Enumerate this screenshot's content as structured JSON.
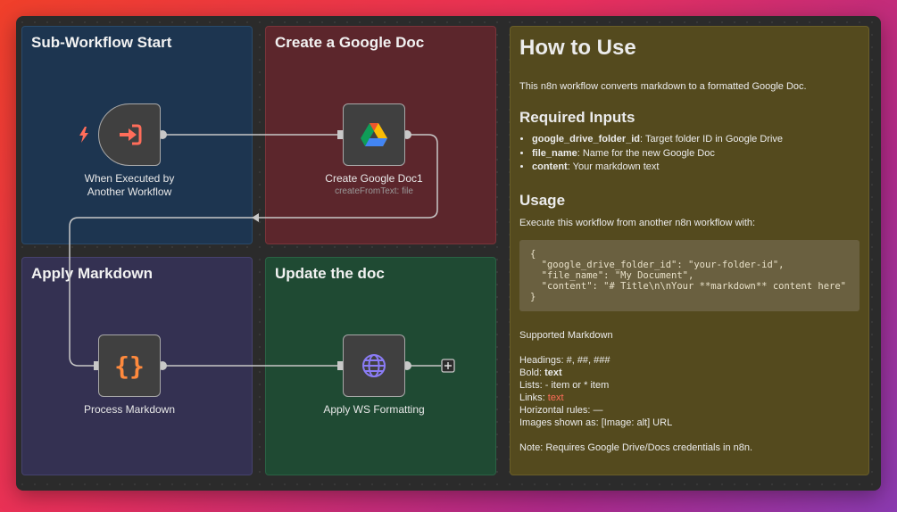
{
  "stickies": {
    "sub_workflow_start": "Sub-Workflow Start",
    "create_google_doc": "Create a Google Doc",
    "apply_markdown": "Apply Markdown",
    "update_the_doc": "Update the doc"
  },
  "nodes": {
    "trigger": {
      "label_line1": "When Executed by",
      "label_line2": "Another Workflow"
    },
    "create_doc": {
      "label": "Create Google Doc1",
      "sublabel": "createFromText: file"
    },
    "process_markdown": {
      "label": "Process Markdown"
    },
    "apply_ws": {
      "label": "Apply WS Formatting"
    }
  },
  "how_to": {
    "title": "How to Use",
    "intro": "This n8n workflow converts markdown to a formatted Google Doc.",
    "required_heading": "Required Inputs",
    "required": [
      {
        "key": "google_drive_folder_id",
        "desc": ": Target folder ID in Google Drive"
      },
      {
        "key": "file_name",
        "desc": ": Name for the new Google Doc"
      },
      {
        "key": "content",
        "desc": ": Your markdown text"
      }
    ],
    "usage_heading": "Usage",
    "usage_text": "Execute this workflow from another n8n workflow with:",
    "code": "{\n  \"google_drive_folder_id\": \"your-folder-id\",\n  \"file_name\": \"My Document\",\n  \"content\": \"# Title\\n\\nYour **markdown** content here\"\n}",
    "supported_heading": "Supported Markdown",
    "headings_line": "Headings: #, ##, ###",
    "bold_prefix": "Bold: ",
    "bold_example": "text",
    "lists_line": "Lists: - item or * item",
    "links_prefix": "Links: ",
    "links_example": "text",
    "rules_line": "Horizontal rules: —",
    "images_line": "Images shown as: [Image: alt] URL",
    "note": "Note: Requires Google Drive/Docs credentials in n8n."
  },
  "colors": {
    "accent": "#ff6d5a",
    "connector": "#c8c8c8",
    "globe": "#8b7cf6"
  }
}
